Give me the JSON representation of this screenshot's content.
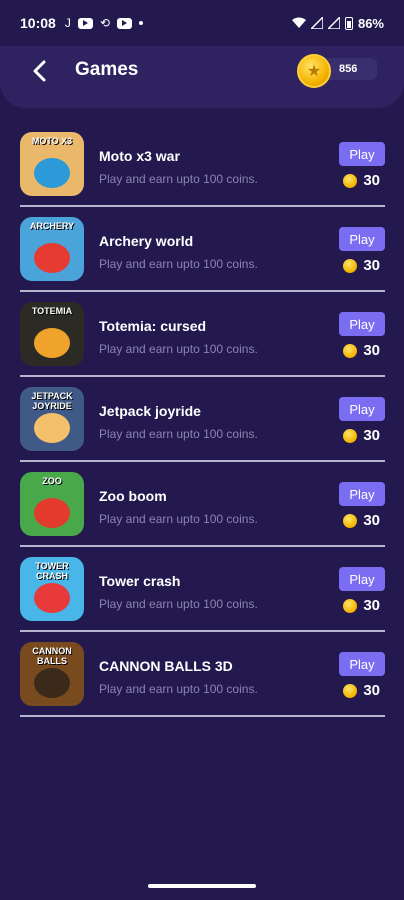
{
  "status_bar": {
    "time": "10:08",
    "letter": "J",
    "battery_percent": "86%"
  },
  "header": {
    "title": "Games",
    "coin_balance": "856"
  },
  "games": [
    {
      "name": "Moto x3 war",
      "description": "Play and earn upto 100 coins.",
      "button": "Play",
      "reward": "30",
      "thumb_text": "MOTO X3",
      "thumb_color": "#e9b86b",
      "art_color": "#2c9ad8"
    },
    {
      "name": "Archery world",
      "description": "Play and earn upto 100 coins.",
      "button": "Play",
      "reward": "30",
      "thumb_text": "ARCHERY",
      "thumb_color": "#4aa3d9",
      "art_color": "#e53b32"
    },
    {
      "name": "Totemia: cursed",
      "description": "Play and earn upto 100 coins.",
      "button": "Play",
      "reward": "30",
      "thumb_text": "TOTEMIA",
      "thumb_color": "#2b2a24",
      "art_color": "#f0a32a"
    },
    {
      "name": "Jetpack joyride",
      "description": "Play and earn upto 100 coins.",
      "button": "Play",
      "reward": "30",
      "thumb_text": "JETPACK JOYRIDE",
      "thumb_color": "#3f5a86",
      "art_color": "#f4c06b"
    },
    {
      "name": "Zoo boom",
      "description": "Play and earn upto 100 coins.",
      "button": "Play",
      "reward": "30",
      "thumb_text": "ZOO",
      "thumb_color": "#49a94a",
      "art_color": "#e23b2e"
    },
    {
      "name": "Tower crash",
      "description": "Play and earn upto 100 coins.",
      "button": "Play",
      "reward": "30",
      "thumb_text": "TOWER CRASH",
      "thumb_color": "#48b6e8",
      "art_color": "#e83a3a"
    },
    {
      "name": "CANNON BALLS 3D",
      "description": "Play and earn upto 100 coins.",
      "button": "Play",
      "reward": "30",
      "thumb_text": "CANNON BALLS",
      "thumb_color": "#7a4a1f",
      "art_color": "#3b2a1a"
    }
  ],
  "colors": {
    "background": "#23194f",
    "header": "#2e2261",
    "play_button": "#7b6df2",
    "coin": "#f4b400",
    "divider": "#b9b4cf"
  }
}
